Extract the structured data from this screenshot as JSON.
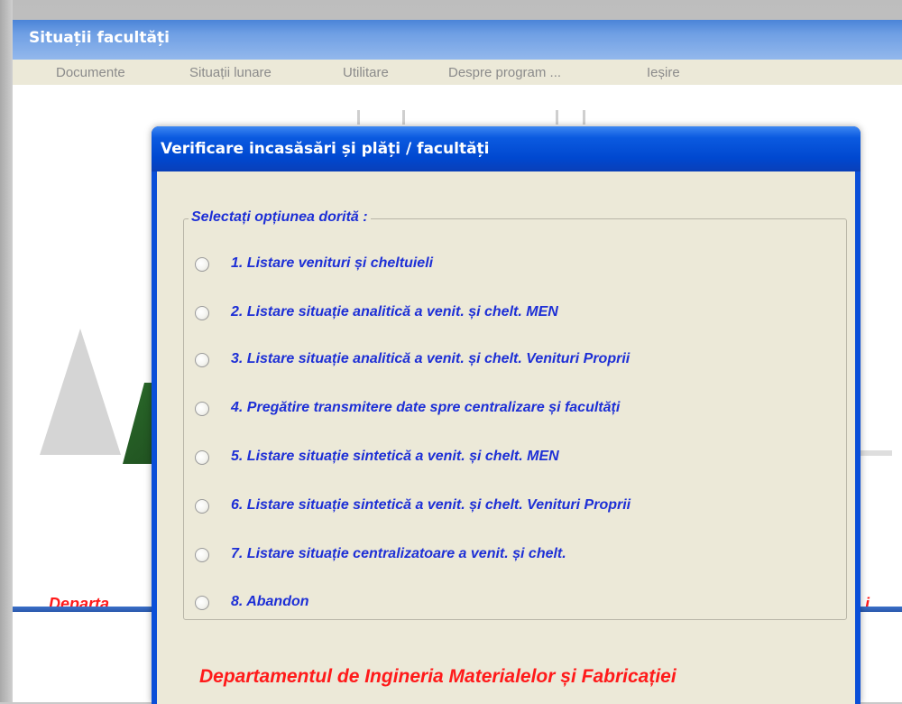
{
  "main_window": {
    "title": "Situații facultăți",
    "menu": [
      "Documente",
      "Situații lunare",
      "Utilitare",
      "Despre program ...",
      "Ieșire"
    ],
    "dept_text_left": "Departa",
    "dept_text_right": "i"
  },
  "dialog": {
    "title": "Verificare incasăsări și plăți / facultăți",
    "group_label": "Selectați opțiunea dorită :",
    "options": [
      "1. Listare venituri și cheltuieli",
      "2. Listare situație analitică a venit. și chelt. MEN",
      "3. Listare situație analitică a venit. și chelt. Venituri Proprii",
      "4. Pregătire transmitere date spre centralizare și facultăți",
      "5. Listare situație sintetică a venit. și chelt. MEN",
      "6. Listare situație sintetică a venit. și chelt. Venituri Proprii",
      "7. Listare situație centralizatoare a venit. și chelt.",
      "8. Abandon"
    ],
    "footer": "Departamentul de Ingineria Materialelor și Fabricației"
  },
  "colors": {
    "option_text": "#1d2fd6",
    "footer_text": "#ff1a1a",
    "dialog_title_bg": "#0048d0",
    "dialog_body_bg": "#ece9d8"
  }
}
